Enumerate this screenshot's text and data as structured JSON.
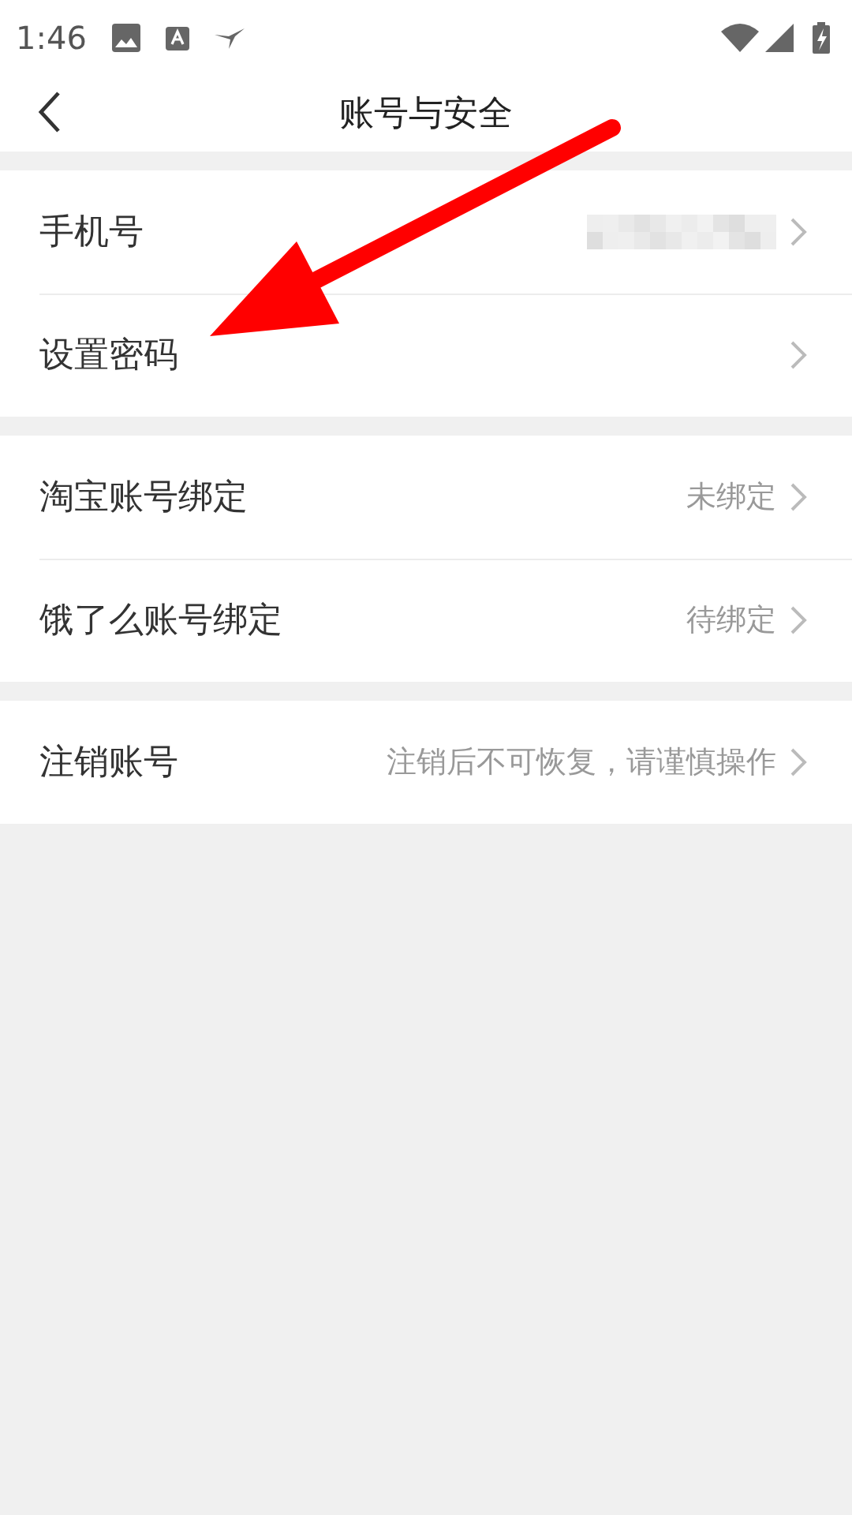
{
  "status_bar": {
    "time": "1:46"
  },
  "header": {
    "title": "账号与安全"
  },
  "groups": [
    {
      "rows": [
        {
          "label": "手机号",
          "kind": "redacted"
        },
        {
          "label": "设置密码",
          "kind": "plain"
        }
      ]
    },
    {
      "rows": [
        {
          "label": "淘宝账号绑定",
          "kind": "text",
          "value": "未绑定"
        },
        {
          "label": "饿了么账号绑定",
          "kind": "text",
          "value": "待绑定"
        }
      ]
    },
    {
      "rows": [
        {
          "label": "注销账号",
          "kind": "text",
          "value": "注销后不可恢复，请谨慎操作"
        }
      ]
    }
  ]
}
